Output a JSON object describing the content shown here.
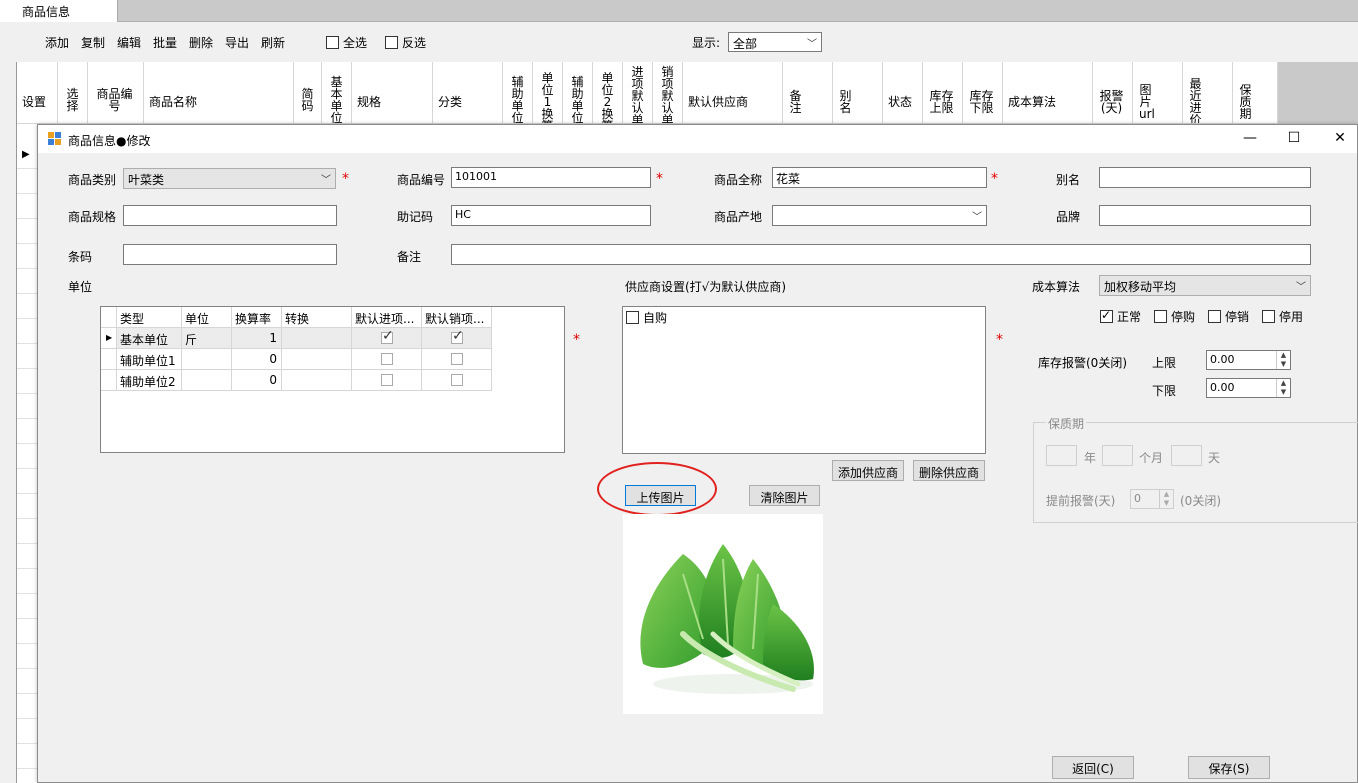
{
  "tab": {
    "label": "商品信息"
  },
  "toolbar": {
    "buttons": [
      "添加",
      "复制",
      "编辑",
      "批量",
      "删除",
      "导出",
      "刷新"
    ],
    "select_all": "全选",
    "invert": "反选",
    "display_label": "显示:",
    "display_value": "全部"
  },
  "grid": {
    "headers": [
      "设置",
      "选择",
      "商品编号",
      "商品名称",
      "简码",
      "基本单位",
      "规格",
      "分类",
      "辅助单位1",
      "单位1换算",
      "辅助单位2",
      "单位2换算",
      "进项默认单",
      "销项默认单",
      "默认供应商",
      "备注",
      "别名",
      "状态",
      "库存上限",
      "库存下限",
      "成本算法",
      "报警(天)",
      "图片url",
      "最近进价",
      "保质期"
    ]
  },
  "dialog": {
    "title": "商品信息●修改",
    "labels": {
      "category": "商品类别",
      "code": "商品编号",
      "fullname": "商品全称",
      "alias": "别名",
      "spec": "商品规格",
      "mnemonic": "助记码",
      "origin": "商品产地",
      "brand": "品牌",
      "barcode": "条码",
      "remark": "备注",
      "unit": "单位",
      "supplier_setting": "供应商设置(打√为默认供应商)",
      "cost_method": "成本算法",
      "stock_alarm": "库存报警(0关闭)",
      "upper": "上限",
      "lower": "下限",
      "shelf_life": "保质期",
      "year": "年",
      "month": "个月",
      "day": "天",
      "advance_alarm": "提前报警(天)",
      "close_hint": "(0关闭)"
    },
    "values": {
      "category": "叶菜类",
      "code": "101001",
      "fullname": "花菜",
      "alias": "",
      "spec": "",
      "mnemonic": "HC",
      "origin": "",
      "brand": "",
      "barcode": "",
      "remark": "",
      "cost_method": "加权移动平均",
      "upper": "0.00",
      "lower": "0.00",
      "advance_alarm": "0"
    },
    "required_mark": "*",
    "status": {
      "normal": "正常",
      "stop_buy": "停购",
      "stop_sell": "停销",
      "disabled": "停用"
    },
    "unit_grid": {
      "columns": [
        "类型",
        "单位",
        "换算率",
        "转换",
        "默认进项...",
        "默认销项..."
      ],
      "rows": [
        {
          "type": "基本单位",
          "unit": "斤",
          "rate": "1",
          "convert": "",
          "in": true,
          "out": true
        },
        {
          "type": "辅助单位1",
          "unit": "",
          "rate": "0",
          "convert": "",
          "in": false,
          "out": false
        },
        {
          "type": "辅助单位2",
          "unit": "",
          "rate": "0",
          "convert": "",
          "in": false,
          "out": false
        }
      ]
    },
    "suppliers": [
      {
        "name": "自购",
        "checked": false
      }
    ],
    "buttons": {
      "add_supplier": "添加供应商",
      "delete_supplier": "删除供应商",
      "upload_image": "上传图片",
      "clear_image": "清除图片",
      "back": "返回(C)",
      "save": "保存(S)"
    },
    "image_icon": "leafy-vegetable-image"
  }
}
